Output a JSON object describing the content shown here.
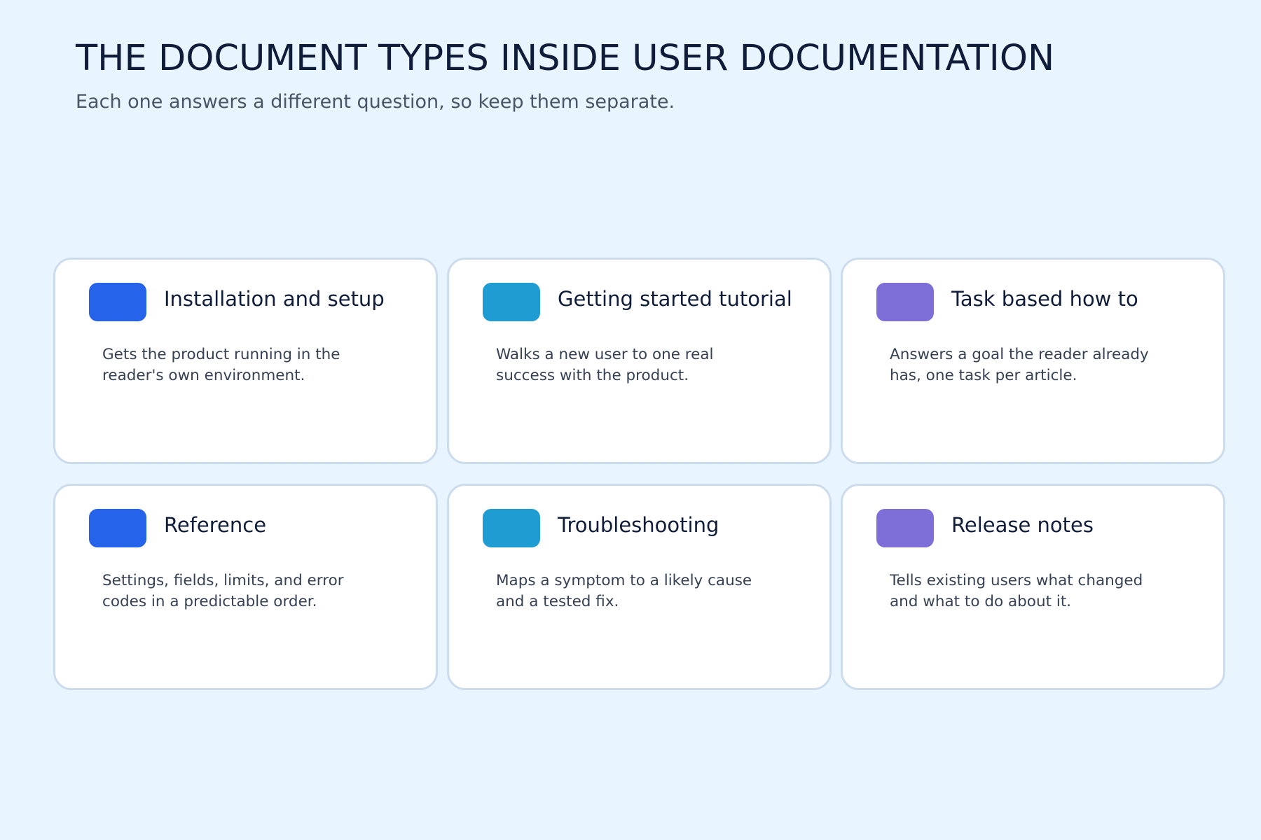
{
  "header": {
    "title": "THE DOCUMENT TYPES INSIDE USER DOCUMENTATION",
    "subtitle": "Each one answers a different question, so keep them separate."
  },
  "colors": {
    "background": "#e8f4fe",
    "card_border": "#ccdcec",
    "blue": "#2563eb",
    "teal": "#1f9dd3",
    "purple": "#7d6ed8"
  },
  "cards": [
    {
      "title": "Installation and setup",
      "description": "Gets the product running in the reader's own environment.",
      "color": "#2563eb"
    },
    {
      "title": "Getting started tutorial",
      "description": "Walks a new user to one real success with the product.",
      "color": "#1f9dd3"
    },
    {
      "title": "Task based how to",
      "description": "Answers a goal the reader already has, one task per article.",
      "color": "#7d6ed8"
    },
    {
      "title": "Reference",
      "description": "Settings, fields, limits, and error codes in a predictable order.",
      "color": "#2563eb"
    },
    {
      "title": "Troubleshooting",
      "description": "Maps a symptom to a likely cause and a tested fix.",
      "color": "#1f9dd3"
    },
    {
      "title": "Release notes",
      "description": "Tells existing users what changed and what to do about it.",
      "color": "#7d6ed8"
    }
  ]
}
